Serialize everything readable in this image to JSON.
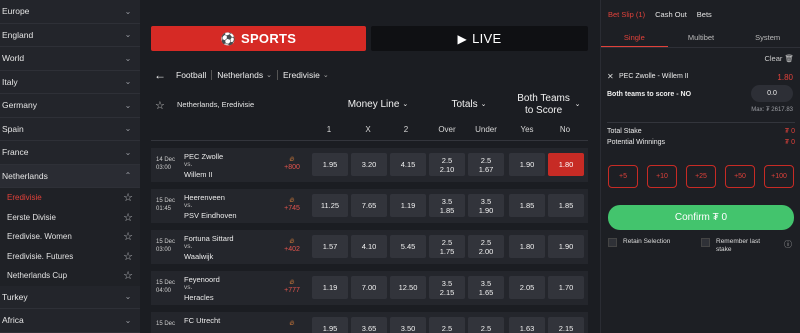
{
  "sidebar": {
    "regions_top": [
      {
        "label": "Europe"
      },
      {
        "label": "England"
      },
      {
        "label": "World"
      },
      {
        "label": "Italy"
      },
      {
        "label": "Germany"
      },
      {
        "label": "Spain"
      },
      {
        "label": "France"
      }
    ],
    "open_region": {
      "label": "Netherlands"
    },
    "leagues": [
      {
        "label": "Eredivisie"
      },
      {
        "label": "Eerste Divisie"
      },
      {
        "label": "Eredivise. Women"
      },
      {
        "label": "Eredivisie. Futures"
      },
      {
        "label": "Netherlands Cup"
      }
    ],
    "regions_bottom": [
      {
        "label": "Turkey"
      },
      {
        "label": "Africa"
      }
    ]
  },
  "main": {
    "sports_label": "SPORTS",
    "live_label": "LIVE",
    "breadcrumb": {
      "football": "Football",
      "country": "Netherlands",
      "league": "Eredivisie"
    },
    "table_league": "Netherlands, Eredivisie",
    "markets": {
      "moneyline": "Money Line",
      "totals": "Totals",
      "btts": "Both Teams to Score"
    },
    "cols": {
      "c1": "1",
      "cx": "X",
      "c2": "2",
      "over": "Over",
      "under": "Under",
      "yes": "Yes",
      "no": "No"
    },
    "matches": [
      {
        "date": "14 Dec",
        "time": "03:00",
        "home": "PEC Zwolle",
        "vs": "vs.",
        "away": "Willem II",
        "more": "+800",
        "o1": "1.95",
        "ox": "3.20",
        "o2": "4.15",
        "ov_line": "2.5",
        "ov_odd": "2.10",
        "un_line": "2.5",
        "un_odd": "1.67",
        "yes": "1.90",
        "no": "1.80"
      },
      {
        "date": "15 Dec",
        "time": "01:45",
        "home": "Heerenveen",
        "vs": "vs.",
        "away": "PSV Eindhoven",
        "more": "+745",
        "o1": "11.25",
        "ox": "7.65",
        "o2": "1.19",
        "ov_line": "3.5",
        "ov_odd": "1.85",
        "un_line": "3.5",
        "un_odd": "1.90",
        "yes": "1.85",
        "no": "1.85"
      },
      {
        "date": "15 Dec",
        "time": "03:00",
        "home": "Fortuna Sittard",
        "vs": "vs.",
        "away": "Waalwijk",
        "more": "+402",
        "o1": "1.57",
        "ox": "4.10",
        "o2": "5.45",
        "ov_line": "2.5",
        "ov_odd": "1.75",
        "un_line": "2.5",
        "un_odd": "2.00",
        "yes": "1.80",
        "no": "1.90"
      },
      {
        "date": "15 Dec",
        "time": "04:00",
        "home": "Feyenoord",
        "vs": "vs.",
        "away": "Heracles",
        "more": "+777",
        "o1": "1.19",
        "ox": "7.00",
        "o2": "12.50",
        "ov_line": "3.5",
        "ov_odd": "2.15",
        "un_line": "3.5",
        "un_odd": "1.65",
        "yes": "2.05",
        "no": "1.70"
      },
      {
        "date": "15 Dec",
        "time": "",
        "home": "FC Utrecht",
        "vs": "",
        "away": "",
        "more": "",
        "o1": "1.95",
        "ox": "3.65",
        "o2": "3.50",
        "ov_line": "2.5",
        "ov_odd": "",
        "un_line": "2.5",
        "un_odd": "",
        "yes": "1.63",
        "no": "2.15"
      }
    ]
  },
  "slip": {
    "tab_betslip": "Bet Slip (1)",
    "tab_cashout": "Cash Out",
    "tab_bets": "Bets",
    "mode_single": "Single",
    "mode_multi": "Multibet",
    "mode_system": "System",
    "clear": "Clear",
    "match": "PEC Zwolle - Willem II",
    "odd": "1.80",
    "market": "Both teams to score - NO",
    "stake_value": "0.0",
    "max": "Max: ₮ 2617.83",
    "total_stake_label": "Total Stake",
    "total_stake_value": "₮ 0",
    "potential_label": "Potential Winnings",
    "potential_value": "₮ 0",
    "quick": [
      "+5",
      "+10",
      "+25",
      "+50",
      "+100"
    ],
    "confirm": "Confirm ₮ 0",
    "retain": "Retain Selection",
    "remember": "Remember last stake"
  }
}
